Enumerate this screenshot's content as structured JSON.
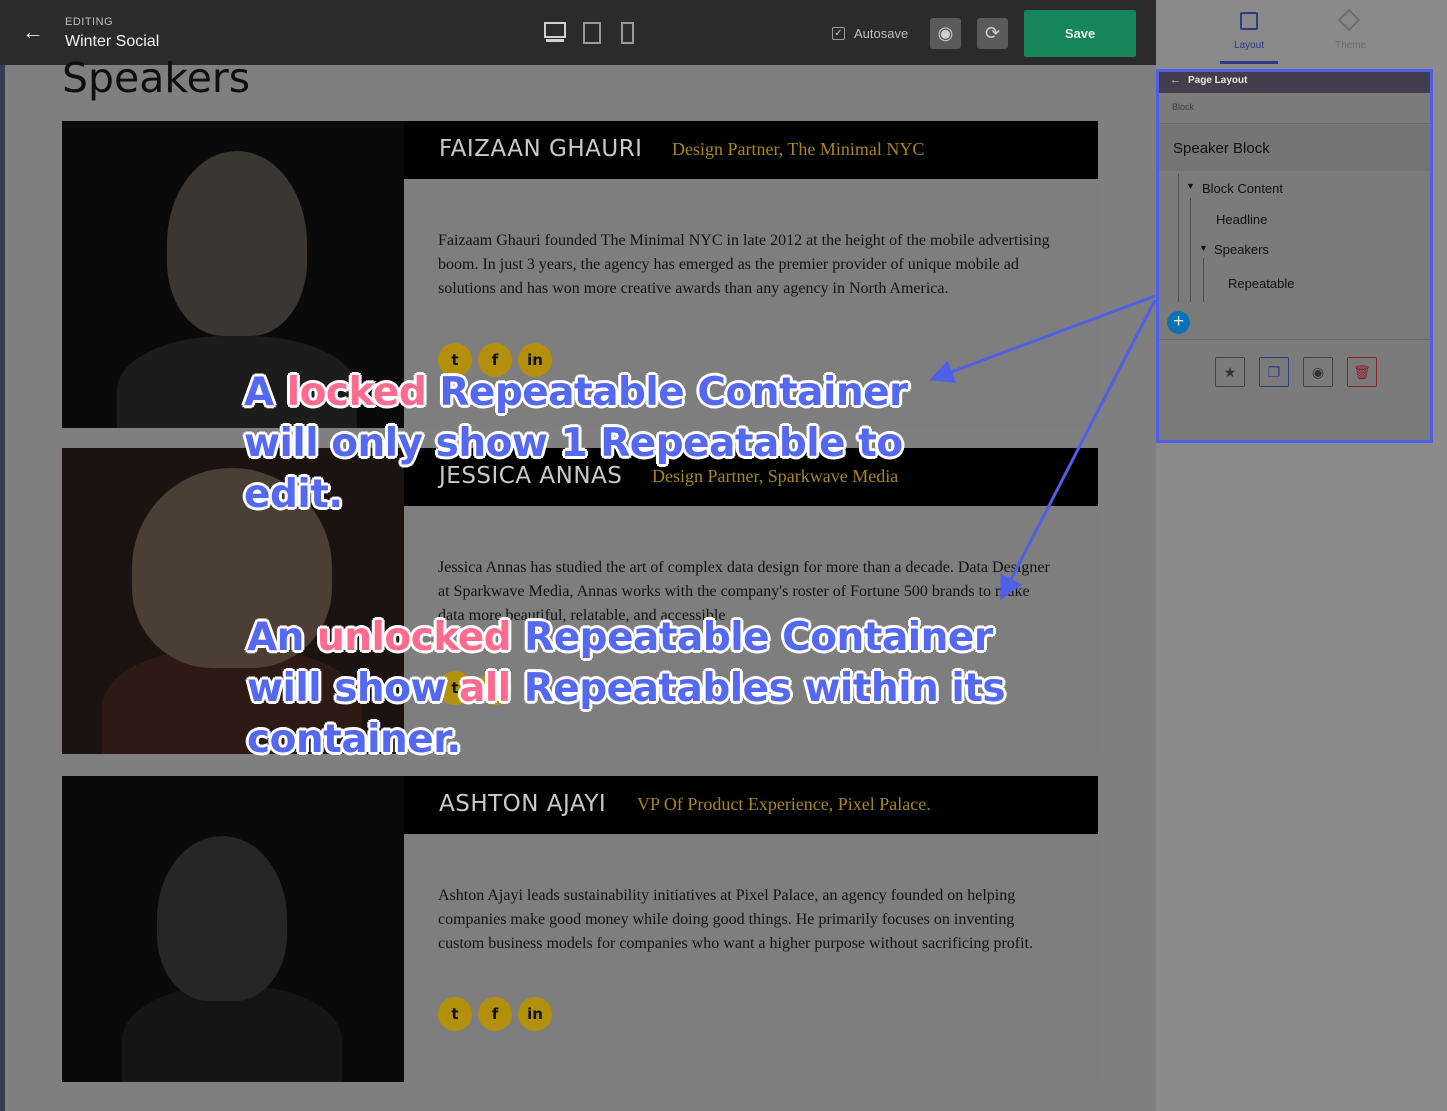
{
  "topbar": {
    "editing_label": "EDITING",
    "page_name": "Winter Social",
    "autosave_label": "Autosave",
    "autosave_checked": true,
    "save_label": "Save",
    "icons": [
      "back-arrow-icon",
      "desktop-icon",
      "tablet-icon",
      "mobile-icon",
      "eye-icon",
      "history-icon"
    ]
  },
  "page": {
    "heading": "Speakers",
    "speakers": [
      {
        "name": "FAIZAAN GHAURI",
        "title": "Design Partner, The Minimal NYC",
        "bio": "Faizaam Ghauri founded The Minimal NYC in late 2012 at the height of the mobile advertising boom. In just 3 years, the agency has emerged as the premier provider of unique mobile ad solutions and has won more creative awards than any agency in North America."
      },
      {
        "name": "JESSICA ANNAS",
        "title": "Design Partner, Sparkwave Media",
        "bio": "Jessica Annas has studied the art of complex data design for more than a decade. Data Designer at Sparkwave Media, Annas works with the company's roster of Fortune 500 brands to make data more beautiful, relatable, and accessible"
      },
      {
        "name": "ASHTON AJAYI",
        "title": "VP Of Product Experience, Pixel Palace.",
        "bio": "Ashton Ajayi leads sustainability initiatives at Pixel Palace, an agency founded on helping companies make good money while doing good things. He primarily focuses on inventing custom business models for companies who want a higher purpose without sacrificing profit."
      }
    ],
    "social_icons": [
      "twitter-icon",
      "facebook-icon",
      "linkedin-icon"
    ]
  },
  "panel": {
    "tabs": [
      {
        "label": "Layout",
        "active": true
      },
      {
        "label": "Theme",
        "active": false
      }
    ],
    "page_layout_label": "Page Layout",
    "block_label": "Block",
    "block_name": "Speaker Block",
    "tree": {
      "block_content": "Block Content",
      "headline": "Headline",
      "speakers": "Speakers",
      "repeatable": "Repeatable"
    },
    "actions": [
      "bookmark-icon",
      "copy-icon",
      "eye-icon",
      "trash-icon"
    ]
  },
  "annotations": {
    "locked": {
      "part1": "A ",
      "highlight": "locked",
      "part2": " Repeatable Container will only show 1 Repeatable to edit."
    },
    "unlocked": {
      "part1": "An ",
      "highlight1": "unlocked",
      "part2": " Repeatable Container will show ",
      "highlight2": "all",
      "part3": " Repeatables within its container."
    },
    "colors": {
      "text": "#5468f0",
      "highlight": "#ff6b8e",
      "arrow": "#4f5fe6"
    }
  }
}
